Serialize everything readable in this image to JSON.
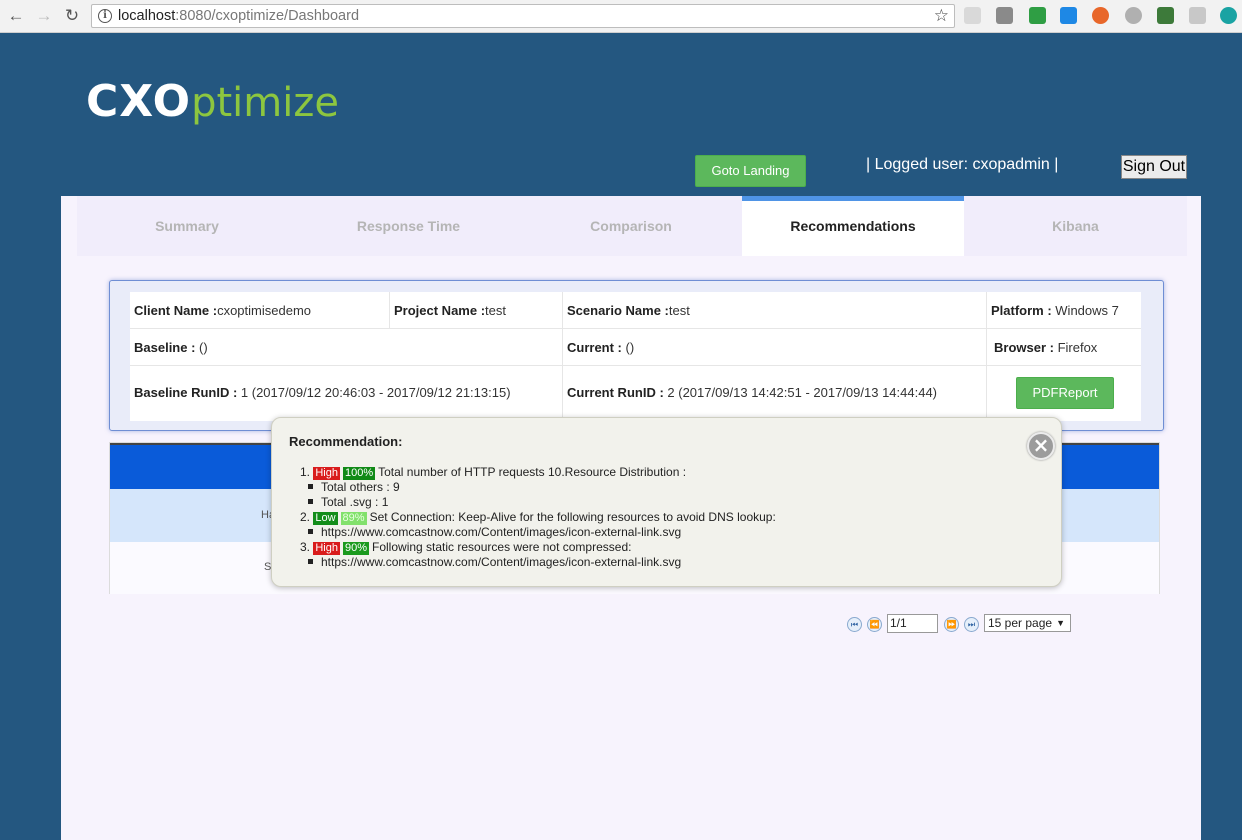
{
  "browser": {
    "url_host": "localhost",
    "url_rest": ":8080/cxoptimize/Dashboard"
  },
  "header": {
    "logo_part1": "CXO",
    "logo_part2": "ptimize",
    "goto_label": "Goto Landing",
    "logged_user": "| Logged user: cxopadmin |",
    "signout_label": "Sign Out"
  },
  "tabs": [
    "Summary",
    "Response Time",
    "Comparison",
    "Recommendations",
    "Kibana"
  ],
  "active_tab": "Recommendations",
  "info": {
    "client_label": "Client Name :",
    "client_value": "cxoptimisedemo",
    "project_label": "Project Name :",
    "project_value": "test",
    "scenario_label": "Scenario Name :",
    "scenario_value": "test",
    "platform_label": "Platform :",
    "platform_value": " Windows 7",
    "baseline_label": "Baseline :",
    "baseline_value": " ()",
    "current_label": "Current :",
    "current_value": " ()",
    "browser_label": "Browser :",
    "browser_value": " Firefox",
    "baseline_run_label": "Baseline RunID :",
    "baseline_run_value": " 1 (2017/09/12 20:46:03 - 2017/09/12 21:13:15)",
    "current_run_label": "Current RunID :",
    "current_run_value": " 2 (2017/09/13 14:42:51 - 2017/09/13 14:44:44)",
    "pdf_label": "PDFReport"
  },
  "table_peek": {
    "row1": "Ha",
    "row2": "S"
  },
  "pager": {
    "page_value": "1/1",
    "per_page": "15 per page"
  },
  "popup": {
    "title": "Recommendation:",
    "items": [
      {
        "num": "1.",
        "priority": "High",
        "percent": "100%",
        "text": "Total number of HTTP requests 10.Resource Distribution :",
        "subs": [
          "Total others : 9",
          "Total .svg : 1"
        ]
      },
      {
        "num": "2.",
        "priority": "Low",
        "percent": "89%",
        "text": "Set Connection: Keep-Alive for the following resources to avoid DNS lookup:",
        "subs": [
          "https://www.comcastnow.com/Content/images/icon-external-link.svg"
        ]
      },
      {
        "num": "3.",
        "priority": "High",
        "percent": "90%",
        "text": "Following static resources were not compressed:",
        "subs": [
          "https://www.comcastnow.com/Content/images/icon-external-link.svg"
        ]
      }
    ]
  },
  "colors": {
    "page_bg": "#245780",
    "accent_green": "#5cb85c",
    "tab_indicator": "#4f94e6",
    "table_header": "#0a5bd9",
    "high_tag": "#d91c1c",
    "low_tag": "#138d1a"
  }
}
